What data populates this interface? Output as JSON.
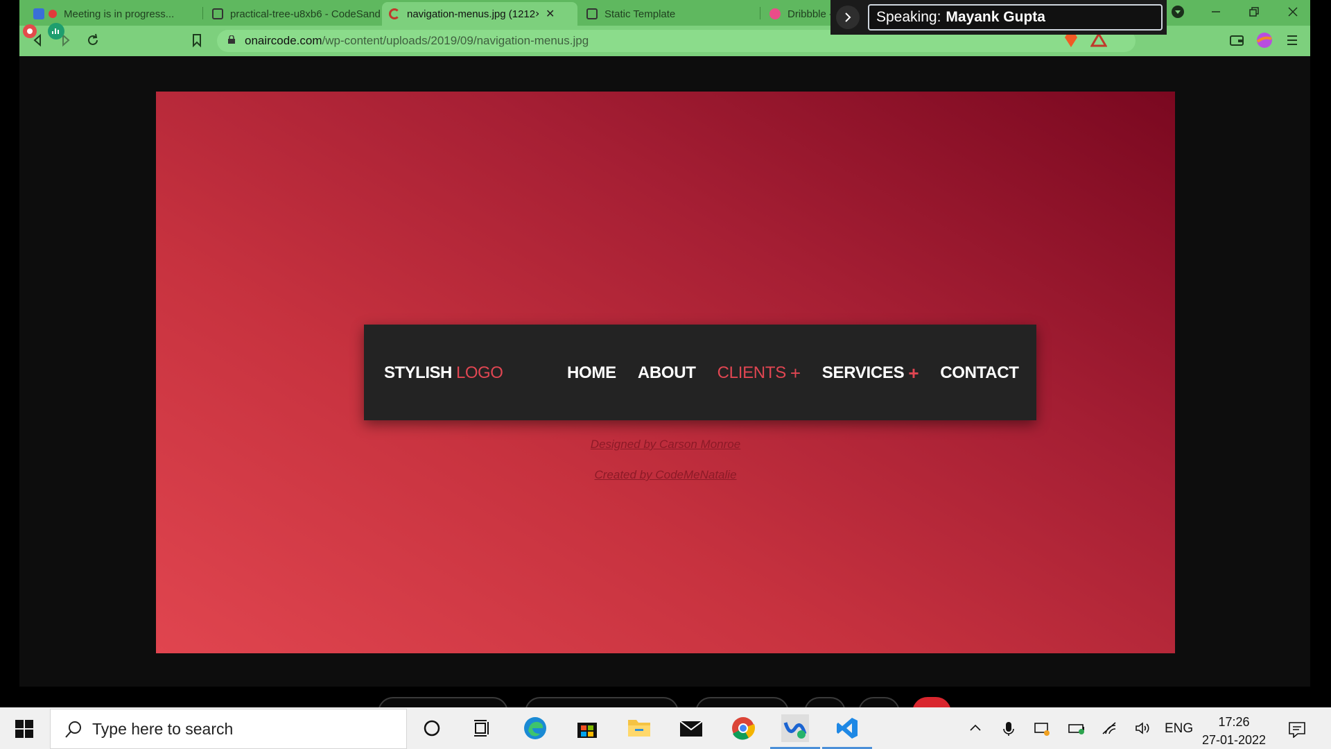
{
  "browser": {
    "tabs": [
      {
        "label": "Meeting is in progress...",
        "favicon_color": "#e23b3b"
      },
      {
        "label": "practical-tree-u8xb6 - CodeSand",
        "favicon_color": "#333333"
      },
      {
        "label": "navigation-menus.jpg (1212×",
        "favicon_color": "#c0392b"
      },
      {
        "label": "Static Template",
        "favicon_color": "#333333"
      },
      {
        "label": "Dribbble -",
        "favicon_color": "#ea4c89"
      }
    ],
    "tab_close": "✕",
    "url_host": "onaircode.com",
    "url_path": "/wp-content/uploads/2019/09/navigation-menus.jpg",
    "speaking_label": "Speaking:",
    "speaking_name": "Mayank Gupta",
    "theme_color": "#7dd07d"
  },
  "page": {
    "nav": {
      "logo_main": "STYLISH",
      "logo_accent": "LOGO",
      "items": [
        {
          "label": "HOME",
          "plus": ""
        },
        {
          "label": "ABOUT",
          "plus": ""
        },
        {
          "label": "CLIENTS",
          "plus": "+"
        },
        {
          "label": "SERVICES",
          "plus": "+"
        },
        {
          "label": "CONTACT",
          "plus": ""
        }
      ],
      "accent_color": "#e04652"
    },
    "credit_designed": "Designed by Carson Monroe",
    "credit_created": "Created by CodeMeNatalie"
  },
  "taskbar": {
    "search_placeholder": "Type here to search",
    "apps": [
      "cortana-icon",
      "task-view-icon",
      "edge-icon",
      "store-icon",
      "file-explorer-icon",
      "mail-icon",
      "chrome-icon",
      "webex-icon",
      "vscode-icon"
    ],
    "language": "ENG",
    "time": "17:26",
    "date": "27-01-2022"
  }
}
